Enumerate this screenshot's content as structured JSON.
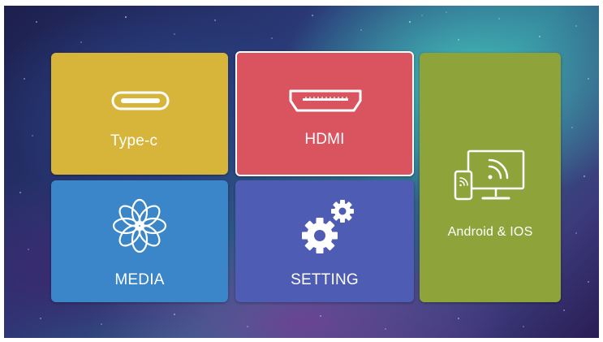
{
  "tiles": {
    "typec": {
      "label": "Type-c",
      "icon": "usb-c-port-icon",
      "color": "#d6b53a"
    },
    "hdmi": {
      "label": "HDMI",
      "icon": "hdmi-port-icon",
      "color": "#d9545f",
      "selected": true
    },
    "media": {
      "label": "MEDIA",
      "icon": "flower-icon",
      "color": "#3a86c8"
    },
    "setting": {
      "label": "SETTING",
      "icon": "gears-icon",
      "color": "#4e5cb3"
    },
    "android": {
      "label": "Android & IOS",
      "icon": "screen-cast-icon",
      "color": "#8ea33a"
    }
  }
}
